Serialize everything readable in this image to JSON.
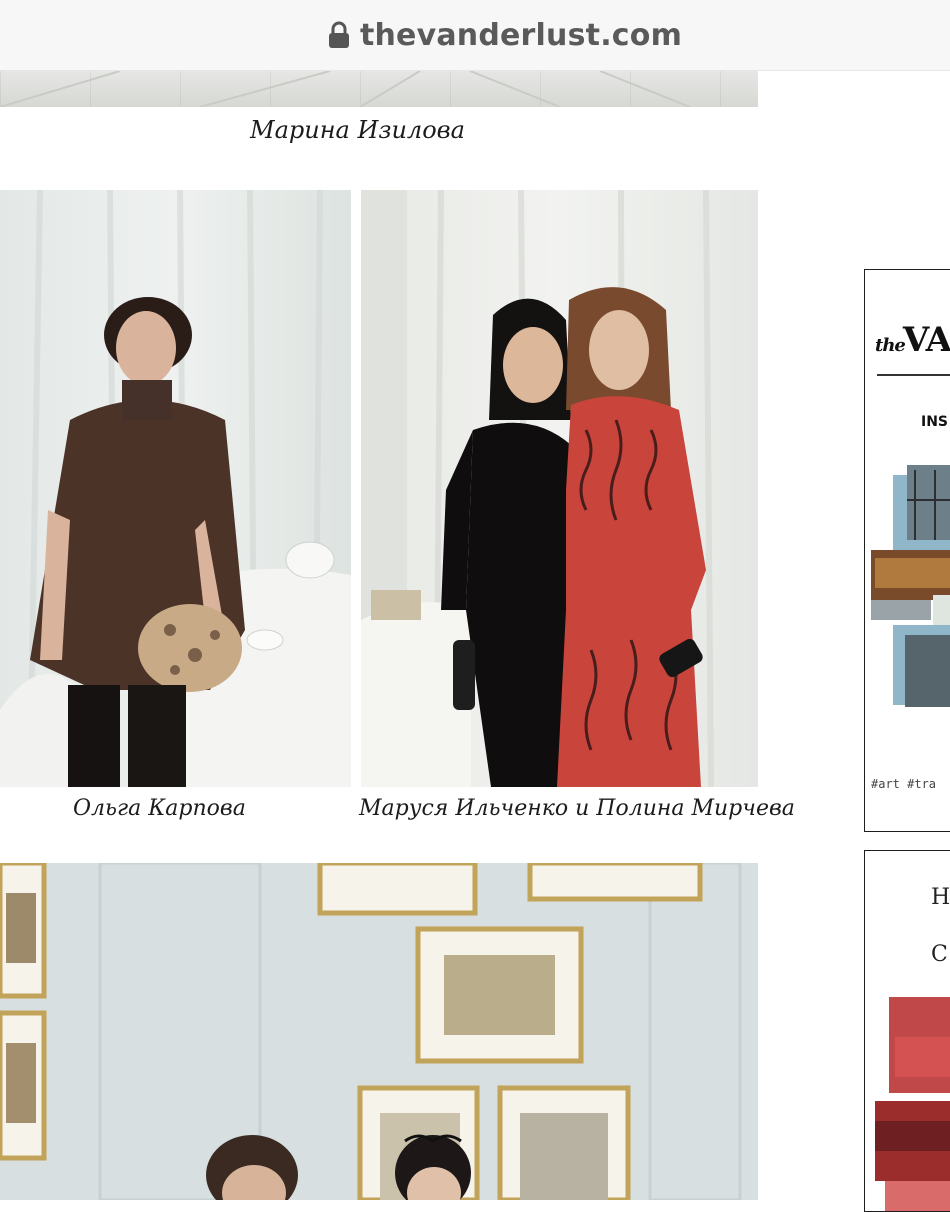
{
  "browser": {
    "url": "thevanderlust.com",
    "lock_icon": "lock-icon"
  },
  "article": {
    "captions": {
      "top": "Марина Изилова",
      "left": "Ольга Карпова",
      "right": "Маруся Ильченко и Полина Мирчева"
    }
  },
  "sidebar": {
    "card1": {
      "brand_the": "the",
      "brand_name": "VA",
      "subtitle": "INS",
      "tags": "#art  #tra"
    },
    "card2": {
      "line1": "H",
      "line2": "C"
    }
  },
  "colors": {
    "url_text": "#5a5a5a",
    "caption_text": "#1c1c1c",
    "card_border": "#1e1e1e"
  }
}
